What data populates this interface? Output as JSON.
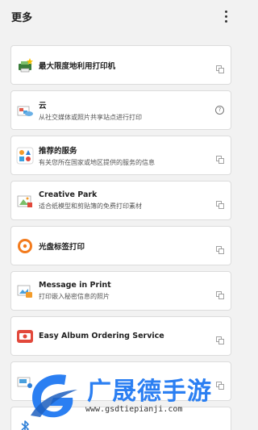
{
  "header": {
    "title": "更多",
    "menu_icon": "more-vert-icon"
  },
  "items": [
    {
      "title": "最大限度地利用打印机",
      "subtitle": "",
      "icon": "printer-star-icon",
      "action_icon": "external-link-icon"
    },
    {
      "title": "云",
      "subtitle": "从社交媒体或照片共享站点进行打印",
      "icon": "cloud-icon",
      "action_icon": "help-icon",
      "help_label": "?"
    },
    {
      "title": "推荐的服务",
      "subtitle": "有关您所在国家或地区提供的服务的信息",
      "icon": "shapes-icon",
      "action_icon": "external-link-icon"
    },
    {
      "title": "Creative Park",
      "subtitle": "适合纸模型和剪贴簿的免费打印素材",
      "icon": "creative-park-icon",
      "action_icon": "external-link-icon"
    },
    {
      "title": "光盘标签打印",
      "subtitle": "",
      "icon": "disc-label-icon",
      "action_icon": "external-link-icon"
    },
    {
      "title": "Message in Print",
      "subtitle": "打印嵌入秘密信息的照片",
      "icon": "message-in-print-icon",
      "action_icon": "external-link-icon"
    },
    {
      "title": "Easy Album Ordering Service",
      "subtitle": "",
      "icon": "album-icon",
      "action_icon": "external-link-icon"
    },
    {
      "title": "",
      "subtitle": "",
      "icon": "printer-icon",
      "action_icon": "external-link-icon"
    },
    {
      "title": "",
      "subtitle": "",
      "icon": "bluetooth-icon",
      "action_icon": ""
    }
  ],
  "watermark": {
    "name": "广晟德手游",
    "url": "www.gsdtiepianji.com"
  },
  "colors": {
    "accent": "#2b7ff2",
    "background": "#f2f2f2",
    "card": "#ffffff"
  }
}
